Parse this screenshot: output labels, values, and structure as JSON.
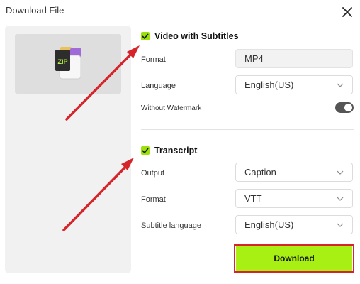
{
  "dialog": {
    "title": "Download File",
    "close_icon": "close-icon"
  },
  "preview": {
    "icon": "zip-file-icon",
    "icon_text": "ZIP"
  },
  "video_section": {
    "label": "Video with Subtitles",
    "checked": true,
    "format_label": "Format",
    "format_value": "MP4",
    "language_label": "Language",
    "language_value": "English(US)",
    "watermark_label": "Without Watermark",
    "watermark_enabled": true
  },
  "transcript_section": {
    "label": "Transcript",
    "checked": true,
    "output_label": "Output",
    "output_value": "Caption",
    "format_label": "Format",
    "format_value": "VTT",
    "subtitle_language_label": "Subtitle language",
    "subtitle_language_value": "English(US)"
  },
  "actions": {
    "download_label": "Download"
  },
  "colors": {
    "accent_green": "#a8ef14",
    "check_green": "#9be00a",
    "annotation_red": "#d5242a"
  }
}
